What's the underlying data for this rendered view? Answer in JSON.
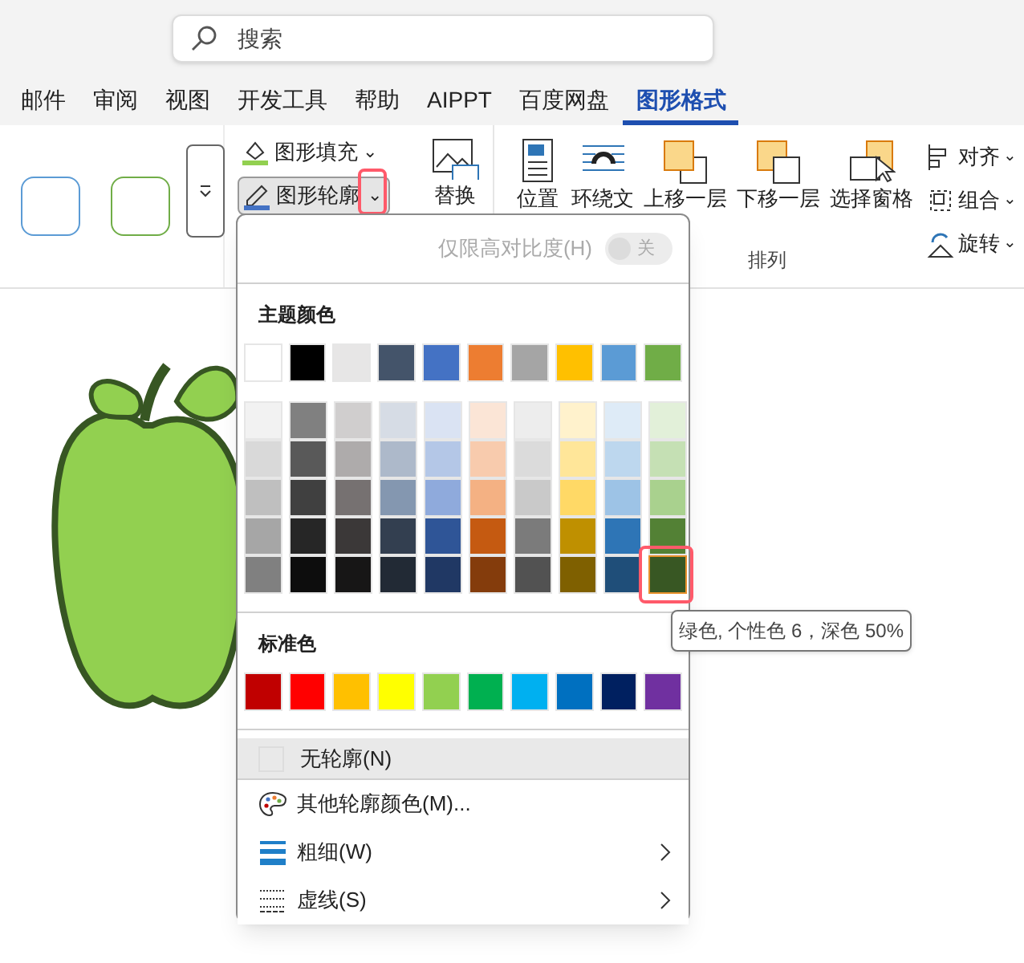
{
  "search": {
    "placeholder": "搜索"
  },
  "tabs": [
    {
      "label": "邮件",
      "selected": false
    },
    {
      "label": "审阅",
      "selected": false
    },
    {
      "label": "视图",
      "selected": false
    },
    {
      "label": "开发工具",
      "selected": false
    },
    {
      "label": "帮助",
      "selected": false
    },
    {
      "label": "AIPPT",
      "selected": false
    },
    {
      "label": "百度网盘",
      "selected": false
    },
    {
      "label": "图形格式",
      "selected": true
    }
  ],
  "ribbon": {
    "shape_styles": [
      {
        "color": "#5b9bd5"
      },
      {
        "color": "#70ad47"
      }
    ],
    "fill_button": {
      "label": "图形填充",
      "caret": "⌄"
    },
    "outline_button": {
      "label": "图形轮廓",
      "caret": "⌄",
      "expanded": true
    },
    "replace_button": {
      "label": "替换"
    },
    "arrange": [
      {
        "kind": "position",
        "label": "位置"
      },
      {
        "kind": "wrap",
        "label": "环绕文"
      },
      {
        "kind": "forward",
        "label": "上移一层"
      },
      {
        "kind": "backward",
        "label": "下移一层"
      },
      {
        "kind": "pane",
        "label": "选择窗格"
      }
    ],
    "side": [
      {
        "kind": "align",
        "label": "对齐",
        "caret": "⌄"
      },
      {
        "kind": "group",
        "label": "组合",
        "caret": "⌄"
      },
      {
        "kind": "rotate",
        "label": "旋转",
        "caret": "⌄"
      }
    ],
    "group_label": "排列"
  },
  "menu": {
    "contrast_toggle": {
      "label": "仅限高对比度(H)",
      "state": "关",
      "on": false,
      "disabled": true
    },
    "theme_title": "主题颜色",
    "theme_colors": [
      {
        "color": "#ffffff",
        "selected": false,
        "shades": [
          {
            "color": "#f2f2f2",
            "selected": false
          },
          {
            "color": "#d9d9d9",
            "selected": false
          },
          {
            "color": "#bfbfbf",
            "selected": false
          },
          {
            "color": "#a6a6a6",
            "selected": false
          },
          {
            "color": "#808080",
            "selected": false
          }
        ]
      },
      {
        "color": "#000000",
        "selected": false,
        "shades": [
          {
            "color": "#808080",
            "selected": false
          },
          {
            "color": "#595959",
            "selected": false
          },
          {
            "color": "#404040",
            "selected": false
          },
          {
            "color": "#262626",
            "selected": false
          },
          {
            "color": "#0d0d0d",
            "selected": false
          }
        ]
      },
      {
        "color": "#e7e6e6",
        "selected": false,
        "shades": [
          {
            "color": "#d0cece",
            "selected": false
          },
          {
            "color": "#aeabab",
            "selected": false
          },
          {
            "color": "#767171",
            "selected": false
          },
          {
            "color": "#3b3838",
            "selected": false
          },
          {
            "color": "#171616",
            "selected": false
          }
        ]
      },
      {
        "color": "#44546a",
        "selected": false,
        "shades": [
          {
            "color": "#d6dce5",
            "selected": false
          },
          {
            "color": "#adb9ca",
            "selected": false
          },
          {
            "color": "#8497b0",
            "selected": false
          },
          {
            "color": "#333f50",
            "selected": false
          },
          {
            "color": "#222a35",
            "selected": false
          }
        ]
      },
      {
        "color": "#4472c4",
        "selected": false,
        "shades": [
          {
            "color": "#dae3f3",
            "selected": false
          },
          {
            "color": "#b4c7e7",
            "selected": false
          },
          {
            "color": "#8faadc",
            "selected": false
          },
          {
            "color": "#2f5597",
            "selected": false
          },
          {
            "color": "#203864",
            "selected": false
          }
        ]
      },
      {
        "color": "#ed7d31",
        "selected": false,
        "shades": [
          {
            "color": "#fbe5d6",
            "selected": false
          },
          {
            "color": "#f8cbad",
            "selected": false
          },
          {
            "color": "#f4b183",
            "selected": false
          },
          {
            "color": "#c55a11",
            "selected": false
          },
          {
            "color": "#843c0c",
            "selected": false
          }
        ]
      },
      {
        "color": "#a5a5a5",
        "selected": false,
        "shades": [
          {
            "color": "#ededed",
            "selected": false
          },
          {
            "color": "#dbdbdb",
            "selected": false
          },
          {
            "color": "#c9c9c9",
            "selected": false
          },
          {
            "color": "#7b7b7b",
            "selected": false
          },
          {
            "color": "#525252",
            "selected": false
          }
        ]
      },
      {
        "color": "#ffc000",
        "selected": false,
        "shades": [
          {
            "color": "#fff2cc",
            "selected": false
          },
          {
            "color": "#ffe699",
            "selected": false
          },
          {
            "color": "#ffd966",
            "selected": false
          },
          {
            "color": "#bf9000",
            "selected": false
          },
          {
            "color": "#7f6000",
            "selected": false
          }
        ]
      },
      {
        "color": "#5b9bd5",
        "selected": false,
        "shades": [
          {
            "color": "#deebf7",
            "selected": false
          },
          {
            "color": "#bdd7ee",
            "selected": false
          },
          {
            "color": "#9dc3e6",
            "selected": false
          },
          {
            "color": "#2e75b6",
            "selected": false
          },
          {
            "color": "#1f4e79",
            "selected": false
          }
        ]
      },
      {
        "color": "#70ad47",
        "selected": false,
        "shades": [
          {
            "color": "#e2f0d9",
            "selected": false
          },
          {
            "color": "#c5e0b4",
            "selected": false
          },
          {
            "color": "#a9d18e",
            "selected": false
          },
          {
            "color": "#538135",
            "selected": false
          },
          {
            "color": "#385723",
            "selected": true
          }
        ]
      }
    ],
    "standard_title": "标准色",
    "standard_colors": [
      {
        "color": "#c00000",
        "selected": false
      },
      {
        "color": "#ff0000",
        "selected": false
      },
      {
        "color": "#ffc000",
        "selected": false
      },
      {
        "color": "#ffff00",
        "selected": false
      },
      {
        "color": "#92d050",
        "selected": false
      },
      {
        "color": "#00b050",
        "selected": false
      },
      {
        "color": "#00b0f0",
        "selected": false
      },
      {
        "color": "#0070c0",
        "selected": false
      },
      {
        "color": "#002060",
        "selected": false
      },
      {
        "color": "#7030a0",
        "selected": false
      }
    ],
    "items": [
      {
        "kind": "no-outline",
        "label": "无轮廓(N)",
        "hovered": true,
        "submenu": false
      },
      {
        "kind": "more-colors",
        "label": "其他轮廓颜色(M)...",
        "hovered": false,
        "submenu": false
      },
      {
        "kind": "weight",
        "label": "粗细(W)",
        "hovered": false,
        "submenu": true
      },
      {
        "kind": "dash",
        "label": "虚线(S)",
        "hovered": false,
        "submenu": true
      }
    ]
  },
  "tooltip": "绿色, 个性色 6，深色 50%"
}
